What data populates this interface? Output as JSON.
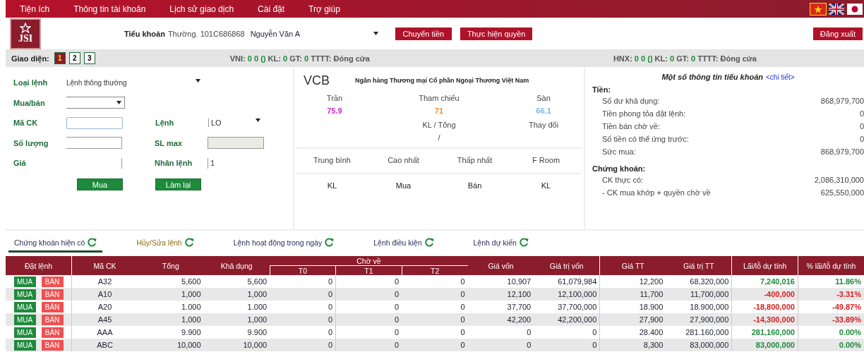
{
  "menu": [
    {
      "label": "Tiện ích"
    },
    {
      "label": "Thông tin tài khoản"
    },
    {
      "label": "Lịch sử giao dịch"
    },
    {
      "label": "Cài đặt"
    },
    {
      "label": "Trợ giúp"
    }
  ],
  "languages": [
    {
      "kind": "vn",
      "selected": true
    },
    {
      "kind": "uk",
      "selected": false
    },
    {
      "kind": "jp",
      "selected": false
    }
  ],
  "logo": {
    "text": "JSI"
  },
  "account": {
    "label": "Tiểu khoản",
    "value": "Thường. 101C686868",
    "owner": "Nguyễn Văn A"
  },
  "header_buttons": [
    "Chuyển tiền",
    "Thực hiện quyền"
  ],
  "logout": "Đăng xuất",
  "layout_label": "Giao diện:",
  "layouts": [
    {
      "label": "1",
      "selected": true
    },
    {
      "label": "2",
      "selected": false
    },
    {
      "label": "3",
      "selected": false
    }
  ],
  "indices": [
    [
      {
        "text": "VNI:",
        "kind": "label"
      },
      {
        "text": "0",
        "kind": "value"
      },
      {
        "text": "0 ()",
        "kind": "value"
      },
      {
        "text": "KL:",
        "kind": "label"
      },
      {
        "text": "0",
        "kind": "value"
      },
      {
        "text": "GT:",
        "kind": "label"
      },
      {
        "text": "0",
        "kind": "value"
      },
      {
        "text": "TTTT: Đóng cửa",
        "kind": "label"
      }
    ],
    [
      {
        "text": "HNX:",
        "kind": "label"
      },
      {
        "text": "0",
        "kind": "value"
      },
      {
        "text": "0 ()",
        "kind": "value"
      },
      {
        "text": "KL:",
        "kind": "label"
      },
      {
        "text": "0",
        "kind": "value"
      },
      {
        "text": "GT:",
        "kind": "label"
      },
      {
        "text": "0",
        "kind": "value"
      },
      {
        "text": "TTTT: Đóng cửa",
        "kind": "label"
      }
    ]
  ],
  "order_form": {
    "order_type": {
      "label": "Loại lệnh",
      "value": "Lệnh thông thường"
    },
    "side": {
      "label": "Mua/bán"
    },
    "symbol": {
      "label": "Mã CK"
    },
    "order": {
      "label": "Lệnh",
      "value": "LO"
    },
    "quantity": {
      "label": "Số lượng"
    },
    "max_quantity": {
      "label": "SL max"
    },
    "price": {
      "label": "Giá"
    },
    "multiplier": {
      "label": "Nhân lệnh",
      "value": "1"
    },
    "buttons": [
      "Mua",
      "Làm lại"
    ]
  },
  "quote": {
    "symbol": "VCB",
    "name": "Ngân hàng Thương mại Cổ phần Ngoại Thương Việt Nam",
    "prices": [
      {
        "label": "Trần",
        "value": "75.9",
        "kind": "ceiling"
      },
      {
        "label": "Tham chiếu",
        "value": "71",
        "kind": "reference"
      },
      {
        "label": "Sàn",
        "value": "66.1",
        "kind": "floor"
      }
    ],
    "volume_label": "KL / Tổng",
    "change_label": "Thay đổi",
    "volume_value": "/",
    "stats": [
      "Trung bình",
      "Cao nhất",
      "Thấp nhất",
      "F Room"
    ],
    "book": [
      "KL",
      "Mua",
      "Bán",
      "KL"
    ]
  },
  "account_info": {
    "title": "Một số thông tin tiểu khoản",
    "link": "<chi tiết>",
    "sections": [
      {
        "title": "Tiền:",
        "rows": [
          {
            "label": "Số dư khả dụng:",
            "value": "868,979,700"
          },
          {
            "label": "Tiền phong tỏa đặt lệnh:",
            "value": "0"
          },
          {
            "label": "Tiền bán chờ về:",
            "value": "0"
          },
          {
            "label": "Số tiền có thể ứng trước:",
            "value": "0"
          },
          {
            "label": "Sức mua:",
            "value": "868,979,700"
          }
        ]
      },
      {
        "title": "Chứng khoán:",
        "rows": [
          {
            "label": "CK thực có:",
            "value": "2,086,310,000"
          },
          {
            "label": "- CK mua khớp + quyền chờ về",
            "value": "625,550,000"
          }
        ]
      }
    ]
  },
  "tabs": [
    {
      "label": "Chứng khoán hiện có",
      "selected": true
    },
    {
      "label": "Hủy/Sửa lệnh",
      "selected": false
    },
    {
      "label": "Lệnh hoạt động trong ngày",
      "selected": false
    },
    {
      "label": "Lệnh điều kiện",
      "selected": false
    },
    {
      "label": "Lệnh dự kiến",
      "selected": false
    }
  ],
  "table": {
    "column_group": "Chờ về",
    "columns": [
      "Đặt lệnh",
      "Mã CK",
      "Tổng",
      "Khả dụng",
      "T0",
      "T1",
      "T2",
      "Giá vốn",
      "Giá trị vốn",
      "Giá TT",
      "Giá trị TT",
      "Lãi/lỗ dự tính",
      "% lãi/lỗ dự tính"
    ],
    "rows": [
      {
        "cells": [
          {
            "buy": "MUA",
            "sell": "BÁN"
          },
          "A32",
          "5,600",
          "5,600",
          "0",
          "0",
          "0",
          "10,907",
          "61,079,984",
          "12,200",
          "68,320,000",
          "7,240,016",
          "11.86%"
        ],
        "gain": true
      },
      {
        "cells": [
          {
            "buy": "MUA",
            "sell": "BÁN"
          },
          "A10",
          "1,000",
          "1,000",
          "0",
          "0",
          "0",
          "12,100",
          "12,100,000",
          "11,700",
          "11,700,000",
          "-400,000",
          "-3.31%"
        ],
        "gain": false
      },
      {
        "cells": [
          {
            "buy": "MUA",
            "sell": "BÁN"
          },
          "A20",
          "1.000",
          "1.000",
          "0",
          "0",
          "0",
          "37,700",
          "37,700,000",
          "18.900",
          "18.900,000",
          "-18,800,000",
          "-49.87%"
        ],
        "gain": false
      },
      {
        "cells": [
          {
            "buy": "MUA",
            "sell": "BÁN"
          },
          "A45",
          "1,000",
          "1,000",
          "0",
          "0",
          "0",
          "42,200",
          "42,200,000",
          "27,900",
          "27,900,000",
          "-14,300,000",
          "-33.89%"
        ],
        "gain": false
      },
      {
        "cells": [
          {
            "buy": "MUA",
            "sell": "BÁN"
          },
          "AAA",
          "9.900",
          "9.900",
          "0",
          "0",
          "0",
          "0",
          "0",
          "28.400",
          "281.160,000",
          "281,160,000",
          "0.00%"
        ],
        "gain": true
      },
      {
        "cells": [
          {
            "buy": "MUA",
            "sell": "BÁN"
          },
          "ABC",
          "10,000",
          "10,000",
          "0",
          "0",
          "0",
          "0",
          "0",
          "8,300",
          "83,000,000",
          "83,000,000",
          "0.00%"
        ],
        "gain": true
      }
    ]
  }
}
